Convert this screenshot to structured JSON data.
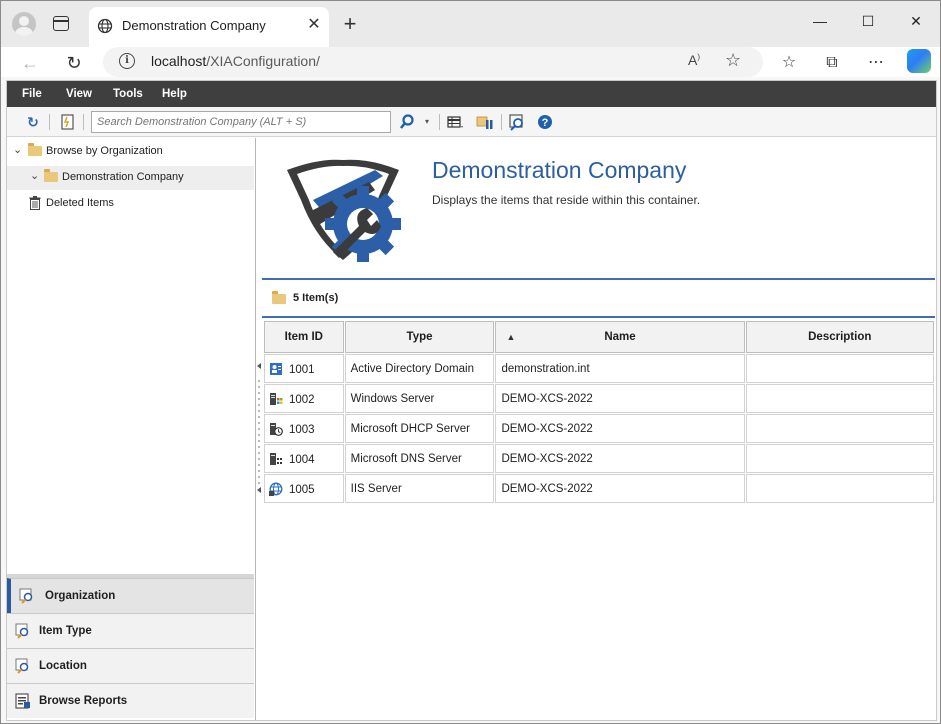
{
  "browser": {
    "tab_title": "Demonstration Company",
    "url_host": "localhost",
    "url_path": "/XIAConfiguration/",
    "icons": [
      "profile-icon",
      "tab-actions-icon",
      "globe-icon",
      "close-icon",
      "new-tab-icon",
      "minimize-icon",
      "maximize-icon",
      "window-close-icon",
      "back-icon",
      "refresh-icon",
      "info-icon",
      "read-aloud-icon",
      "favorite-star-icon",
      "favorites-icon",
      "collections-icon",
      "more-icon",
      "copilot-icon"
    ]
  },
  "menu": {
    "file": "File",
    "view": "View",
    "tools": "Tools",
    "help": "Help"
  },
  "toolbar": {
    "search_placeholder": "Search Demonstration Company (ALT + S)",
    "icons": [
      "refresh-icon",
      "report-icon",
      "search-icon",
      "dropdown-icon",
      "grid-view-icon",
      "folder-columns-icon",
      "find-icon",
      "help-icon"
    ]
  },
  "tree": {
    "root": "Browse by Organization",
    "child": "Demonstration Company",
    "deleted": "Deleted Items"
  },
  "accordion": {
    "items": [
      {
        "label": "Organization",
        "active": true
      },
      {
        "label": "Item Type",
        "active": false
      },
      {
        "label": "Location",
        "active": false
      },
      {
        "label": "Browse Reports",
        "active": false
      }
    ]
  },
  "header": {
    "title": "Demonstration Company",
    "description": "Displays the items that reside within this container."
  },
  "items": {
    "count_label": "5 Item(s)",
    "columns": [
      "Item ID",
      "Type",
      "Name",
      "Description"
    ],
    "sorted_column": "Name",
    "rows": [
      {
        "id": "1001",
        "type": "Active Directory Domain",
        "name": "demonstration.int",
        "description": "",
        "icon": "active-directory-icon"
      },
      {
        "id": "1002",
        "type": "Windows Server",
        "name": "DEMO-XCS-2022",
        "description": "",
        "icon": "windows-server-icon"
      },
      {
        "id": "1003",
        "type": "Microsoft DHCP Server",
        "name": "DEMO-XCS-2022",
        "description": "",
        "icon": "dhcp-server-icon"
      },
      {
        "id": "1004",
        "type": "Microsoft DNS Server",
        "name": "DEMO-XCS-2022",
        "description": "",
        "icon": "dns-server-icon"
      },
      {
        "id": "1005",
        "type": "IIS Server",
        "name": "DEMO-XCS-2022",
        "description": "",
        "icon": "iis-server-icon"
      }
    ]
  },
  "colors": {
    "accent_blue": "#2c5f9e",
    "menubar": "#3f3f3f",
    "divider": "#3f6fb1"
  }
}
